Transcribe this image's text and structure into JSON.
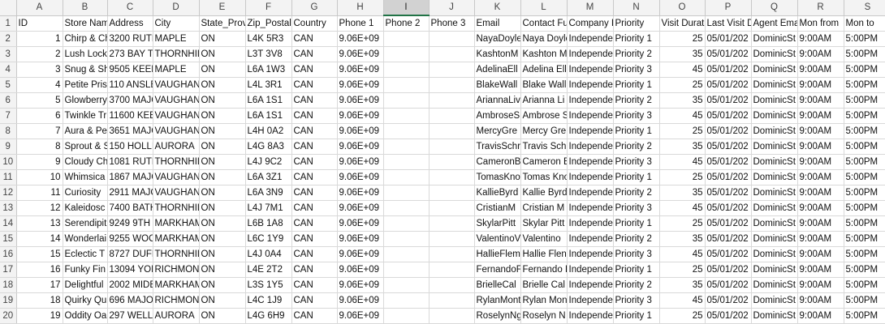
{
  "columns": [
    "A",
    "B",
    "C",
    "D",
    "E",
    "F",
    "G",
    "H",
    "I",
    "J",
    "K",
    "L",
    "M",
    "N",
    "O",
    "P",
    "Q",
    "R",
    "S"
  ],
  "selected_column": "I",
  "header_row": [
    "ID",
    "Store Nam",
    "Address",
    "City",
    "State_Prov",
    "Zip_Postal",
    "Country",
    "Phone 1",
    "Phone 2",
    "Phone 3",
    "Email",
    "Contact Fu",
    "Company I",
    "Priority",
    "Visit Durat",
    "Last Visit D",
    "Agent Ema",
    "Mon from",
    "Mon to"
  ],
  "rows": [
    [
      "1",
      "Chirp & Ch",
      "3200 RUTH",
      "MAPLE",
      "ON",
      "L4K 5R3",
      "CAN",
      "9.06E+09",
      "",
      "",
      "NayaDoyle",
      "Naya Doyle",
      "Independe",
      "Priority 1",
      "25",
      "05/01/202",
      "DominicSt",
      "9:00AM",
      "5:00PM"
    ],
    [
      "2",
      "Lush Lock",
      "273 BAY TH",
      "THORNHIL",
      "ON",
      "L3T 3V8",
      "CAN",
      "9.06E+09",
      "",
      "",
      "KashtonM",
      "Kashton M",
      "Independe",
      "Priority 2",
      "35",
      "05/01/202",
      "DominicSt",
      "9:00AM",
      "5:00PM"
    ],
    [
      "3",
      "Snug & Shi",
      "9505 KEEL",
      "MAPLE",
      "ON",
      "L6A 1W3",
      "CAN",
      "9.06E+09",
      "",
      "",
      "AdelinaEll",
      "Adelina Ell",
      "Independe",
      "Priority 3",
      "45",
      "05/01/202",
      "DominicSt",
      "9:00AM",
      "5:00PM"
    ],
    [
      "4",
      "Petite Pris",
      "110 ANSLE",
      "VAUGHAN",
      "ON",
      "L4L 3R1",
      "CAN",
      "9.06E+09",
      "",
      "",
      "BlakeWall",
      "Blake Wall",
      "Independe",
      "Priority 1",
      "25",
      "05/01/202",
      "DominicSt",
      "9:00AM",
      "5:00PM"
    ],
    [
      "5",
      "Glowberry",
      "3700 MAJC",
      "VAUGHAN",
      "ON",
      "L6A 1S1",
      "CAN",
      "9.06E+09",
      "",
      "",
      "AriannaLiv",
      "Arianna Li",
      "Independe",
      "Priority 2",
      "35",
      "05/01/202",
      "DominicSt",
      "9:00AM",
      "5:00PM"
    ],
    [
      "6",
      "Twinkle Tr",
      "11600 KEE",
      "VAUGHAN",
      "ON",
      "L6A 1S1",
      "CAN",
      "9.06E+09",
      "",
      "",
      "AmbroseS",
      "Ambrose S",
      "Independe",
      "Priority 3",
      "45",
      "05/01/202",
      "DominicSt",
      "9:00AM",
      "5:00PM"
    ],
    [
      "7",
      "Aura & Pet",
      "3651 MAJC",
      "VAUGHAN",
      "ON",
      "L4H 0A2",
      "CAN",
      "9.06E+09",
      "",
      "",
      "MercyGre",
      "Mercy Gre",
      "Independe",
      "Priority 1",
      "25",
      "05/01/202",
      "DominicSt",
      "9:00AM",
      "5:00PM"
    ],
    [
      "8",
      "Sprout & S",
      "150 HOLLI",
      "AURORA",
      "ON",
      "L4G 8A3",
      "CAN",
      "9.06E+09",
      "",
      "",
      "TravisSchr",
      "Travis Schi",
      "Independe",
      "Priority 2",
      "35",
      "05/01/202",
      "DominicSt",
      "9:00AM",
      "5:00PM"
    ],
    [
      "9",
      "Cloudy Ch",
      "1081 RUTH",
      "THORNHIL",
      "ON",
      "L4J 9C2",
      "CAN",
      "9.06E+09",
      "",
      "",
      "CameronB",
      "Cameron E",
      "Independe",
      "Priority 3",
      "45",
      "05/01/202",
      "DominicSt",
      "9:00AM",
      "5:00PM"
    ],
    [
      "10",
      "Whimsica",
      "1867 MAJC",
      "VAUGHAN",
      "ON",
      "L6A 3Z1",
      "CAN",
      "9.06E+09",
      "",
      "",
      "TomasKno",
      "Tomas Kno",
      "Independe",
      "Priority 1",
      "25",
      "05/01/202",
      "DominicSt",
      "9:00AM",
      "5:00PM"
    ],
    [
      "11",
      "Curiosity",
      "2911 MAJC",
      "VAUGHAN",
      "ON",
      "L6A 3N9",
      "CAN",
      "9.06E+09",
      "",
      "",
      "KallieByrd",
      "Kallie Byrd",
      "Independe",
      "Priority 2",
      "35",
      "05/01/202",
      "DominicSt",
      "9:00AM",
      "5:00PM"
    ],
    [
      "12",
      "Kaleidosc",
      "7400 BATH",
      "THORNHIL",
      "ON",
      "L4J 7M1",
      "CAN",
      "9.06E+09",
      "",
      "",
      "CristianM",
      "Cristian M",
      "Independe",
      "Priority 3",
      "45",
      "05/01/202",
      "DominicSt",
      "9:00AM",
      "5:00PM"
    ],
    [
      "13",
      "Serendipit",
      "9249 9TH L",
      "MARKHAM",
      "ON",
      "L6B 1A8",
      "CAN",
      "9.06E+09",
      "",
      "",
      "SkylarPitt",
      "Skylar Pitt",
      "Independe",
      "Priority 1",
      "25",
      "05/01/202",
      "DominicSt",
      "9:00AM",
      "5:00PM"
    ],
    [
      "14",
      "Wonderlai",
      "9255 WOO",
      "MARKHAM",
      "ON",
      "L6C 1Y9",
      "CAN",
      "9.06E+09",
      "",
      "",
      "ValentinoV",
      "Valentino",
      "Independe",
      "Priority 2",
      "35",
      "05/01/202",
      "DominicSt",
      "9:00AM",
      "5:00PM"
    ],
    [
      "15",
      "Eclectic T",
      "8727 DUFF",
      "THORNHIL",
      "ON",
      "L4J 0A4",
      "CAN",
      "9.06E+09",
      "",
      "",
      "HallieFlem",
      "Hallie Flen",
      "Independe",
      "Priority 3",
      "45",
      "05/01/202",
      "DominicSt",
      "9:00AM",
      "5:00PM"
    ],
    [
      "16",
      "Funky Fin",
      "13094 YON",
      "RICHMON",
      "ON",
      "L4E 2T2",
      "CAN",
      "9.06E+09",
      "",
      "",
      "FernandoF",
      "Fernando I",
      "Independe",
      "Priority 1",
      "25",
      "05/01/202",
      "DominicSt",
      "9:00AM",
      "5:00PM"
    ],
    [
      "17",
      "Delightful",
      "2002 MIDE",
      "MARKHAM",
      "ON",
      "L3S 1Y5",
      "CAN",
      "9.06E+09",
      "",
      "",
      "BrielleCal",
      "Brielle Cal",
      "Independe",
      "Priority 2",
      "35",
      "05/01/202",
      "DominicSt",
      "9:00AM",
      "5:00PM"
    ],
    [
      "18",
      "Quirky Qu",
      "696 MAJOF",
      "RICHMON",
      "ON",
      "L4C 1J9",
      "CAN",
      "9.06E+09",
      "",
      "",
      "RylanMont",
      "Rylan Mon",
      "Independe",
      "Priority 3",
      "45",
      "05/01/202",
      "DominicSt",
      "9:00AM",
      "5:00PM"
    ],
    [
      "19",
      "Oddity Oa",
      "297 WELLI",
      "AURORA",
      "ON",
      "L4G 6H9",
      "CAN",
      "9.06E+09",
      "",
      "",
      "RoselynNg",
      "Roselyn N",
      "Independe",
      "Priority 1",
      "25",
      "05/01/202",
      "DominicSt",
      "9:00AM",
      "5:00PM"
    ]
  ]
}
